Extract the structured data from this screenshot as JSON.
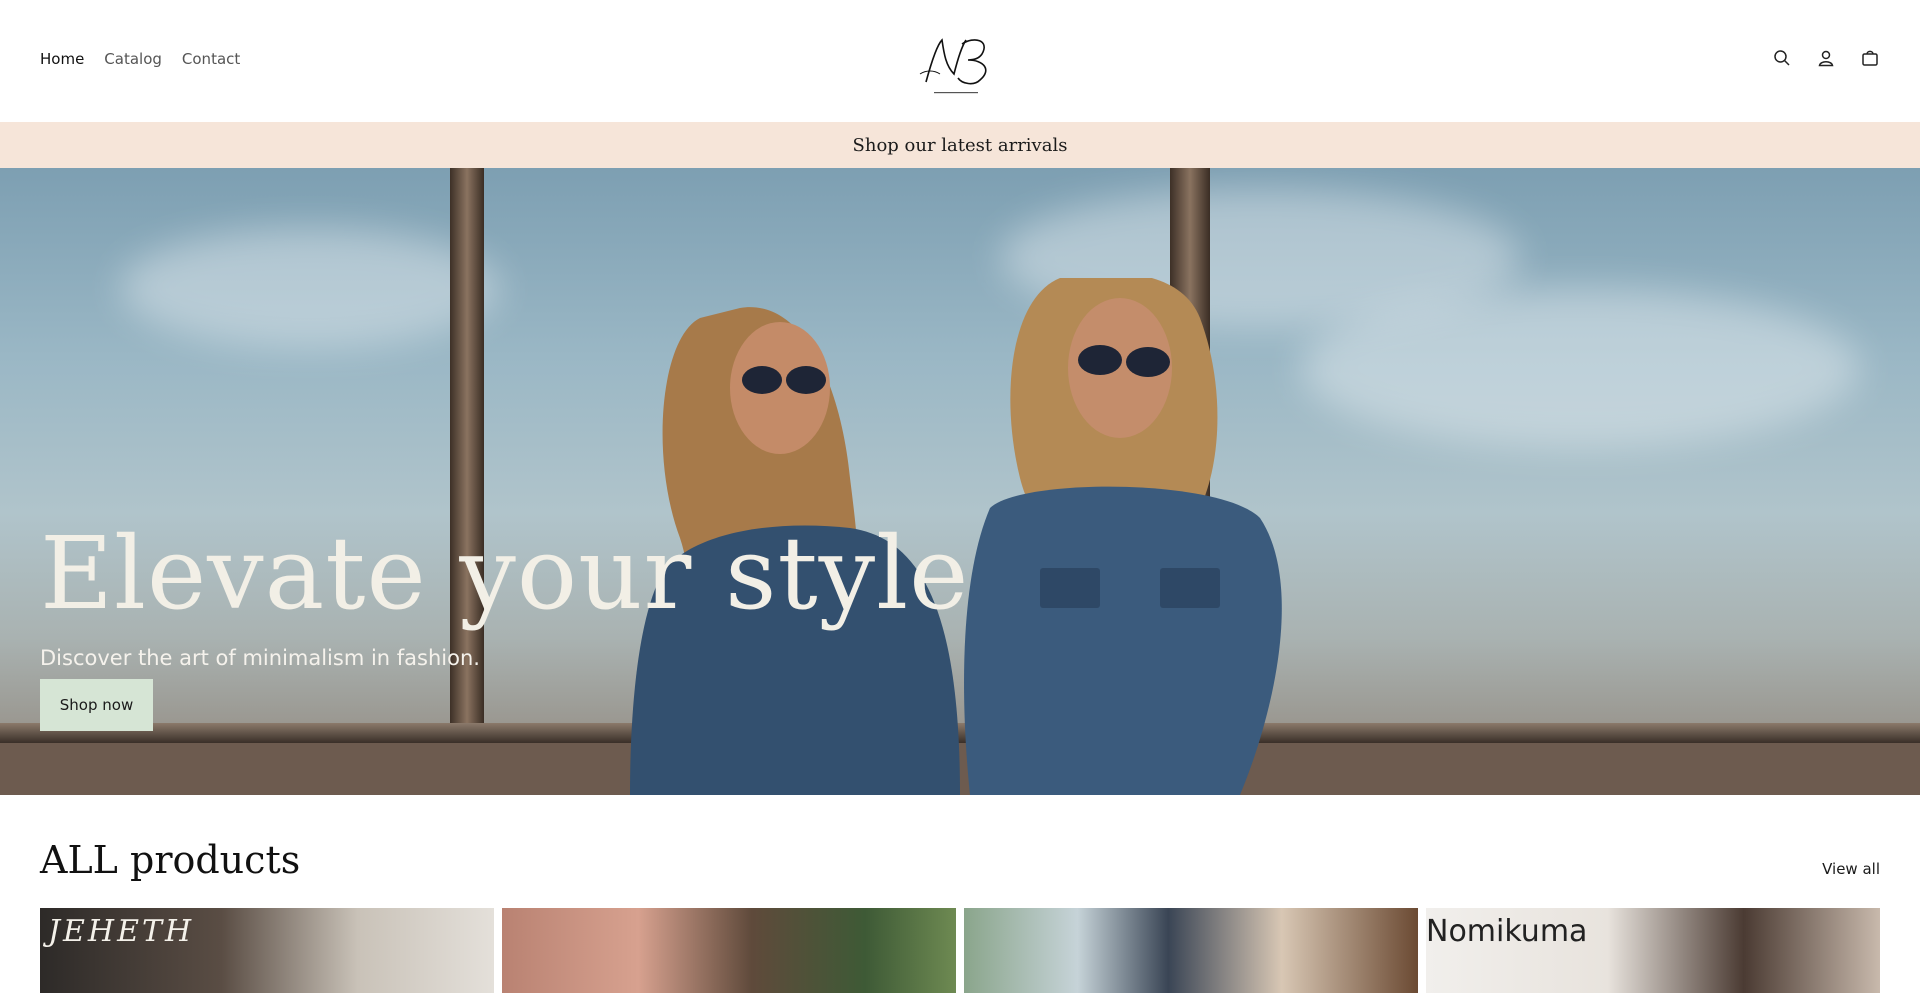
{
  "header": {
    "nav": [
      "Home",
      "Catalog",
      "Contact"
    ],
    "logo_alt": "NB",
    "icons": [
      "search-icon",
      "account-icon",
      "cart-icon"
    ]
  },
  "announcement": {
    "text": "Shop our latest arrivals"
  },
  "hero": {
    "title": "Elevate your style",
    "subtitle": "Discover the art of minimalism in fashion.",
    "cta": "Shop now"
  },
  "products": {
    "title": "ALL products",
    "view_all": "View all",
    "cards": [
      {
        "label": "JEHETH"
      },
      {
        "label": ""
      },
      {
        "label": ""
      },
      {
        "label": "Nomikuma"
      }
    ]
  },
  "colors": {
    "announcement_bg": "#f6e5d9",
    "cta_bg": "#d6e5d5",
    "hero_text": "#f2efe6"
  }
}
